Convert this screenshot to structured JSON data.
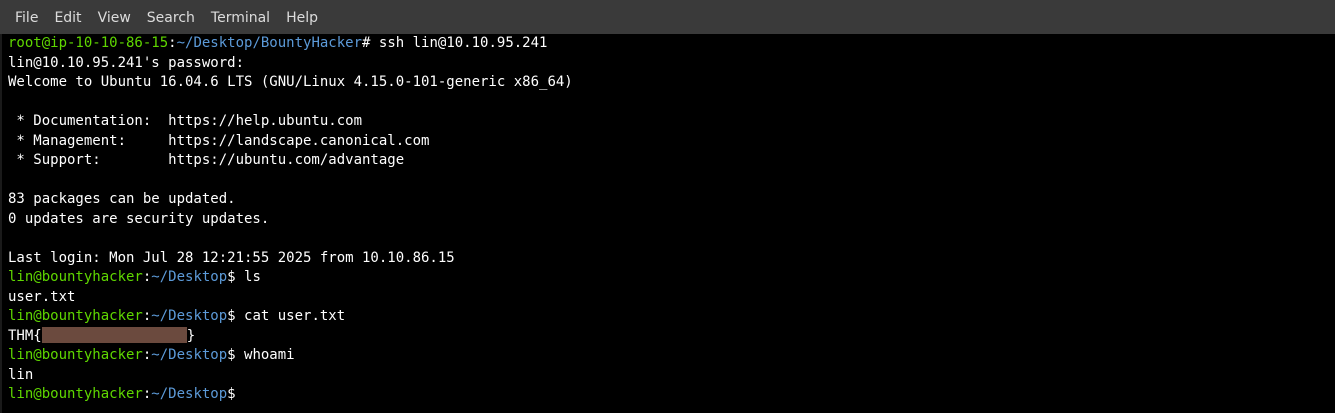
{
  "menu": {
    "items": [
      "File",
      "Edit",
      "View",
      "Search",
      "Terminal",
      "Help"
    ]
  },
  "colors": {
    "prompt_user": "#5fd700",
    "prompt_path": "#5c9ad8",
    "text": "#ffffff",
    "background": "#000000",
    "redaction": "#6b4a3e"
  },
  "terminal": {
    "l1": {
      "user": "root@ip-10-10-86-15",
      "sep": ":",
      "path": "~/Desktop/BountyHacker",
      "end": "# ",
      "cmd": "ssh lin@10.10.95.241"
    },
    "l2": "lin@10.10.95.241's password:",
    "l3": "Welcome to Ubuntu 16.04.6 LTS (GNU/Linux 4.15.0-101-generic x86_64)",
    "l4": "",
    "l5": " * Documentation:  https://help.ubuntu.com",
    "l6": " * Management:     https://landscape.canonical.com",
    "l7": " * Support:        https://ubuntu.com/advantage",
    "l8": "",
    "l9": "83 packages can be updated.",
    "l10": "0 updates are security updates.",
    "l11": "",
    "l12": "Last login: Mon Jul 28 12:21:55 2025 from 10.10.86.15",
    "p1": {
      "user": "lin@bountyhacker",
      "sep": ":",
      "path": "~/Desktop",
      "end": "$ ",
      "cmd": "ls"
    },
    "o1": "user.txt",
    "p2": {
      "user": "lin@bountyhacker",
      "sep": ":",
      "path": "~/Desktop",
      "end": "$ ",
      "cmd": "cat user.txt"
    },
    "flag_prefix": "THM{",
    "flag_suffix": "}",
    "p3": {
      "user": "lin@bountyhacker",
      "sep": ":",
      "path": "~/Desktop",
      "end": "$ ",
      "cmd": "whoami"
    },
    "o3": "lin",
    "p4": {
      "user": "lin@bountyhacker",
      "sep": ":",
      "path": "~/Desktop",
      "end": "$ ",
      "cmd": ""
    }
  }
}
